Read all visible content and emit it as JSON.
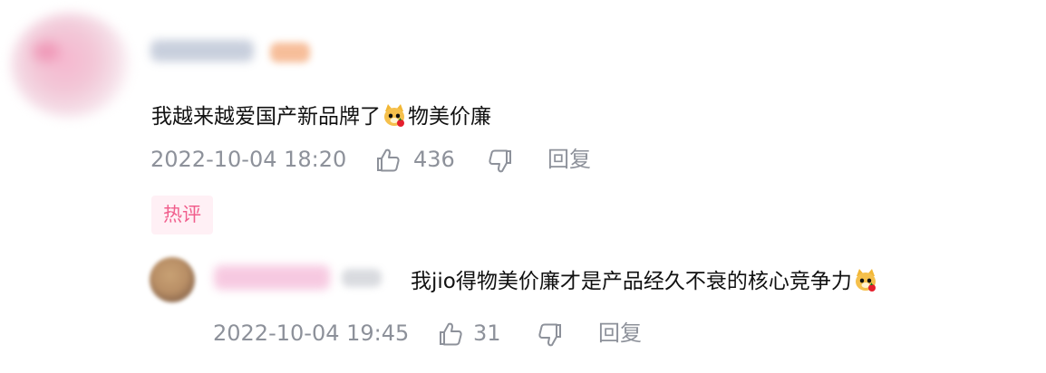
{
  "comments": {
    "main": {
      "text_1": "我越来越爱国产新品牌了",
      "text_2": "物美价廉",
      "timestamp": "2022-10-04 18:20",
      "likes": "436",
      "reply_label": "回复"
    },
    "reply": {
      "text_1": "我jio得物美价廉才是产品经久不衰的核心竞争力",
      "timestamp": "2022-10-04 19:45",
      "likes": "31",
      "reply_label": "回复"
    }
  },
  "tags": {
    "hot_comment": "热评"
  },
  "icons": {
    "like": "thumbs-up-icon",
    "dislike": "thumbs-down-icon",
    "emoji": "cat-emoji-icon"
  },
  "colors": {
    "text_primary": "#111111",
    "text_meta": "#8d919a",
    "hot_tag_text": "#f15f8d",
    "hot_tag_bg": "#fff0f5"
  }
}
